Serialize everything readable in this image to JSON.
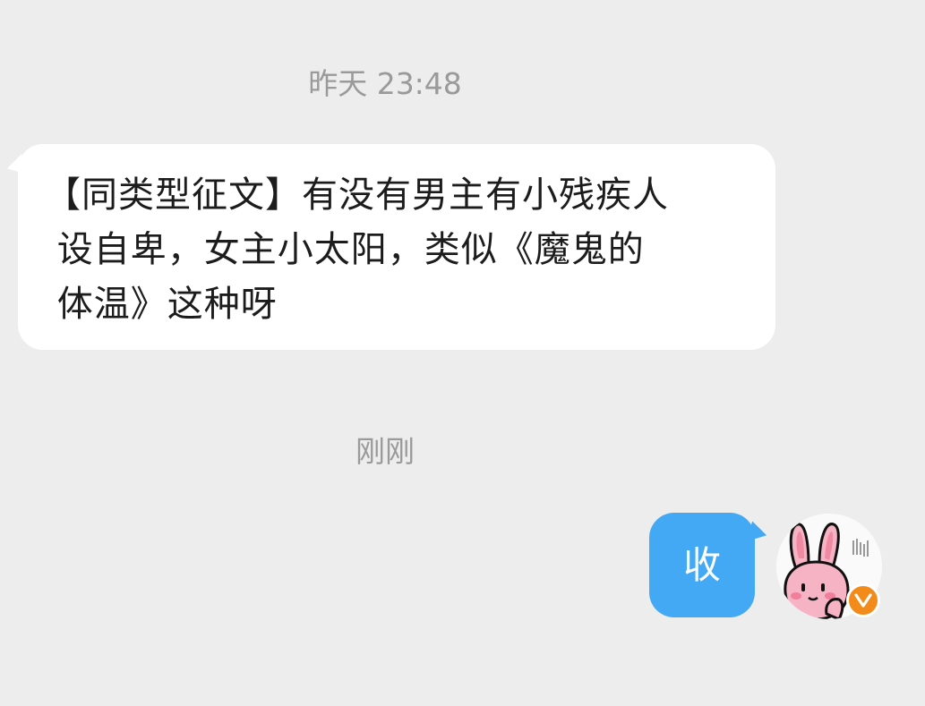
{
  "chat": {
    "messages": [
      {
        "timestamp": "昨天 23:48",
        "direction": "incoming",
        "text": "【同类型征文】有没有男主有小残疾人设自卑，女主小太阳，类似《魔鬼的体温》这种呀"
      },
      {
        "timestamp": "刚刚",
        "direction": "outgoing",
        "text": "收"
      }
    ],
    "incoming_text_lines": [
      "【同类型征文】有没有男主有小残疾人",
      " 设自卑，女主小太阳，类似《魔鬼的",
      " 体温》这种呀"
    ]
  },
  "user": {
    "avatar_icon": "pink-bunny-avatar-icon",
    "verified_icon": "verified-v-badge-icon"
  },
  "colors": {
    "background": "#ededed",
    "incoming_bubble": "#ffffff",
    "outgoing_bubble": "#43a9f5",
    "timestamp_text": "#9a9a9a",
    "badge": "#f28b1a"
  }
}
